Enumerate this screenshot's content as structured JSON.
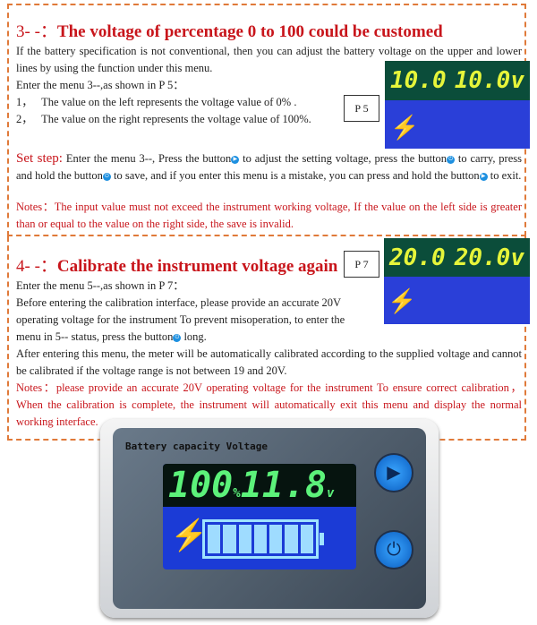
{
  "s3": {
    "num": "3- -：",
    "title": "The voltage of percentage 0 to 100 could be customed",
    "p1": "If the battery specification is not conventional, then you can adjust the battery voltage on the upper and lower lines by using the function under this menu.",
    "p2": "Enter the menu 3--,as shown in P 5：",
    "i1n": "1，",
    "i1": "The value on the left represents the voltage value of 0% .",
    "i2n": "2，",
    "i2": "The value on the right represents the voltage value of 100%.",
    "pl": "P 5",
    "lcd_left": "10.0",
    "lcd_right": "10.0v",
    "set_label": "Set step:",
    "set_a": " Enter the menu 3--, Press the button",
    "set_b": " to adjust the setting voltage, press the button",
    "set_c": " to carry, press and hold the button",
    "set_d": " to save, and if you enter this menu is a mistake, you can press and hold the button",
    "set_e": " to exit.",
    "notes": "Notes：The input value must not exceed the instrument working voltage, If the value on the left side is greater than or equal to the value on the right side, the save is invalid."
  },
  "s4": {
    "num": "4- -：",
    "title": "Calibrate the instrument voltage again",
    "pl": "P 7",
    "lcd_left": "20.0",
    "lcd_right": "20.0v",
    "p1": "Enter the menu 5--,as shown in P 7：",
    "p2a": "Before entering the calibration interface, please provide an accurate 20V operating voltage for the instrument To prevent misoperation, to enter the menu in 5-- status, press the button",
    "p2b": " long.",
    "p3": "After entering this menu, the meter will be automatically calibrated according to the supplied voltage and cannot be calibrated if the voltage range is not between 19 and 20V.",
    "notes": "Notes：please provide an accurate 20V operating voltage for the instrument To ensure correct calibration，When the calibration is complete, the instrument will automatically exit this menu and display the normal working interface."
  },
  "device": {
    "label": "Battery capacity Voltage",
    "percent": "100",
    "percent_unit": "%",
    "voltage": "11.8",
    "voltage_unit": "v",
    "battery_level_percent": 100
  },
  "colors": {
    "accent": "#c8151b",
    "border": "#e07a3a",
    "lcd_digits": "#e6f53a"
  }
}
